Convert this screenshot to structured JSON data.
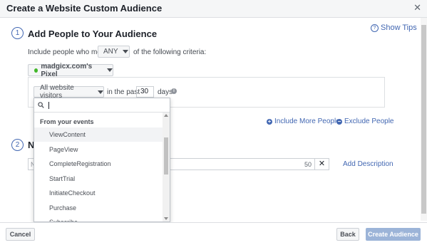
{
  "dialog": {
    "title": "Create a Website Custom Audience",
    "close_glyph": "✕"
  },
  "show_tips": {
    "label": "Show Tips",
    "icon": "?"
  },
  "step1": {
    "number": "1",
    "title": "Add People to Your Audience",
    "criteria_prefix": "Include people who meet",
    "match_value": "ANY",
    "criteria_suffix": "of the following criteria:"
  },
  "pixel": {
    "label": "madgicx.com's Pixel",
    "status_color": "#42b72a"
  },
  "rule": {
    "visitors_label": "All website visitors",
    "in_the_past": "in the past",
    "days_value": "30",
    "days_label": "days",
    "info_icon": "i"
  },
  "links": {
    "include_more": "Include More People",
    "exclude": "Exclude People",
    "add_description": "Add Description"
  },
  "step2": {
    "number": "2",
    "title_partial": "Na",
    "input_partial": "N",
    "char_count": "50",
    "clear_glyph": "✕"
  },
  "dropdown": {
    "search_value": "",
    "group_label": "From your events",
    "items": [
      {
        "label": "ViewContent"
      },
      {
        "label": "PageView"
      },
      {
        "label": "CompleteRegistration"
      },
      {
        "label": "StartTrial"
      },
      {
        "label": "InitiateCheckout"
      },
      {
        "label": "Purchase"
      },
      {
        "label": "Subscribe"
      }
    ]
  },
  "footer": {
    "cancel": "Cancel",
    "back": "Back",
    "create": "Create Audience"
  },
  "colors": {
    "accent": "#4267b2",
    "disabled_button": "#9cb4d8"
  }
}
